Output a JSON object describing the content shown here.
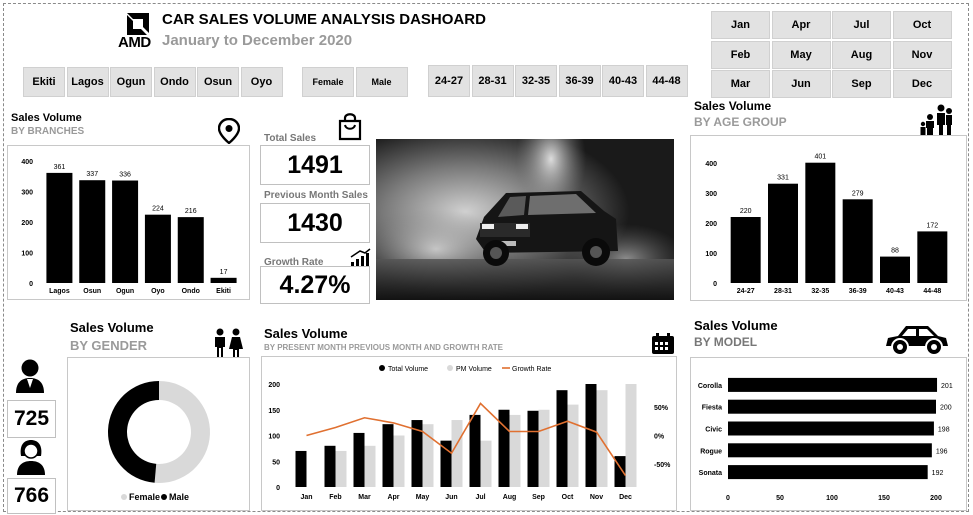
{
  "header": {
    "logo_text": "AMD",
    "title": "CAR SALES VOLUME ANALYSIS DASHOARD",
    "subtitle": "January to December 2020"
  },
  "branch_slicer": [
    "Ekiti",
    "Lagos",
    "Ogun",
    "Ondo",
    "Osun",
    "Oyo"
  ],
  "gender_slicer": [
    "Female",
    "Male"
  ],
  "age_slicer": [
    "24-27",
    "28-31",
    "32-35",
    "36-39",
    "40-43",
    "44-48"
  ],
  "month_slicer": [
    "Jan",
    "Apr",
    "Jul",
    "Oct",
    "Feb",
    "May",
    "Aug",
    "Nov",
    "Mar",
    "Jun",
    "Sep",
    "Dec"
  ],
  "kpis": {
    "total_sales_label": "Total Sales",
    "total_sales": "1491",
    "prev_month_label": "Previous Month Sales",
    "prev_month": "1430",
    "growth_label": "Growth Rate",
    "growth": "4.27%"
  },
  "gender_kpis": {
    "male": "725",
    "female": "766"
  },
  "icons": [
    "location-pin-icon",
    "shopping-bag-icon",
    "growth-chart-icon",
    "family-icon",
    "couple-icon",
    "calendar-icon",
    "car-icon",
    "male-user-icon",
    "female-user-icon"
  ],
  "chart_data": [
    {
      "id": "branches",
      "type": "bar",
      "title": "Sales Volume",
      "subtitle": "BY BRANCHES",
      "categories": [
        "Lagos",
        "Osun",
        "Ogun",
        "Oyo",
        "Ondo",
        "Ekiti"
      ],
      "values": [
        361,
        337,
        336,
        224,
        216,
        17
      ],
      "yticks": [
        0,
        100,
        200,
        300,
        400
      ],
      "ylim": [
        0,
        400
      ],
      "color": "#000000"
    },
    {
      "id": "age",
      "type": "bar",
      "title": "Sales Volume",
      "subtitle": "BY AGE GROUP",
      "categories": [
        "24-27",
        "28-31",
        "32-35",
        "36-39",
        "40-43",
        "44-48"
      ],
      "values": [
        220,
        331,
        401,
        279,
        88,
        172
      ],
      "yticks": [
        0,
        100,
        200,
        300,
        400
      ],
      "ylim": [
        0,
        400
      ],
      "color": "#000000"
    },
    {
      "id": "gender",
      "type": "pie",
      "title": "Sales Volume",
      "subtitle": "BY GENDER",
      "labels": [
        "Female",
        "Male"
      ],
      "values": [
        766,
        725
      ],
      "colors": [
        "#d9d9d9",
        "#000000"
      ]
    },
    {
      "id": "monthly",
      "type": "bar",
      "title": "Sales Volume",
      "subtitle": "BY PRESENT MONTH  PREVIOUS MONTH AND GROWTH RATE",
      "categories": [
        "Jan",
        "Feb",
        "Mar",
        "Apr",
        "May",
        "Jun",
        "Jul",
        "Aug",
        "Sep",
        "Oct",
        "Nov",
        "Dec"
      ],
      "series": [
        {
          "name": "Total Volume",
          "values": [
            70,
            80,
            105,
            122,
            130,
            90,
            140,
            150,
            148,
            188,
            200,
            60
          ],
          "color": "#000000"
        },
        {
          "name": "PM Volume",
          "values": [
            0,
            70,
            80,
            100,
            122,
            130,
            90,
            140,
            150,
            160,
            188,
            200
          ],
          "color": "#d9d9d9"
        },
        {
          "name": "Growth Rate",
          "type": "line",
          "values": [
            0.0,
            0.14,
            0.31,
            0.22,
            0.07,
            -0.31,
            0.56,
            0.07,
            0.07,
            0.25,
            0.06,
            -0.7
          ],
          "color": "#e07030"
        }
      ],
      "yticks": [
        0,
        50,
        100,
        150,
        200
      ],
      "ylim": [
        0,
        200
      ],
      "y2ticks": [
        "50%",
        "0%",
        "-50%"
      ],
      "y2lim": [
        -0.9,
        0.9
      ]
    },
    {
      "id": "model",
      "type": "bar",
      "orientation": "horizontal",
      "title": "Sales Volume",
      "subtitle": "BY MODEL",
      "categories": [
        "Corolla",
        "Fiesta",
        "Civic",
        "Rogue",
        "Sonata"
      ],
      "values": [
        201,
        200,
        198,
        196,
        192
      ],
      "xticks": [
        0,
        50,
        100,
        150,
        200
      ],
      "xlim": [
        0,
        200
      ],
      "color": "#000000"
    }
  ]
}
